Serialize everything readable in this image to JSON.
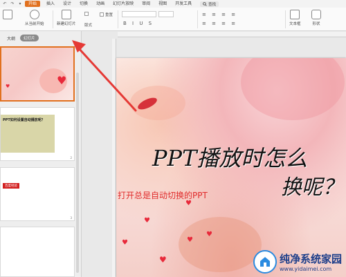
{
  "ribbon": {
    "tabs": [
      "开始",
      "插入",
      "设计",
      "切换",
      "动画",
      "幻灯片放映",
      "审阅",
      "视图",
      "开发工具"
    ],
    "active_tab": "开始",
    "search_label": "查找"
  },
  "toolbar": {
    "from_current": "从当前开始",
    "new_slide": "新建幻灯片",
    "layout": "版式",
    "reset": "重置",
    "textbox": "文本框",
    "shape": "形状"
  },
  "panel": {
    "outline_label": "大纲",
    "slides_label": "幻灯片",
    "thumb2_title": "PPT如何设置自动播放呢？",
    "thumb3_label": "百度经验"
  },
  "slide": {
    "title_line1": "PPT播放时怎么",
    "title_line2": "换呢？",
    "subtitle": "打开总是自动切换的PPT"
  },
  "watermark": {
    "name": "纯净系统家园",
    "url": "www.yidaimei.com"
  },
  "colors": {
    "accent": "#e1701e",
    "arrow": "#e53935",
    "subtitle": "#e02b2b"
  }
}
